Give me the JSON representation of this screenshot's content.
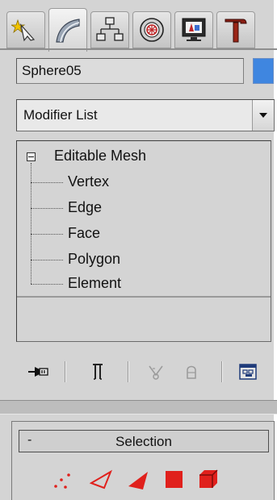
{
  "command_panel": {
    "tabs": [
      {
        "icon": "create-icon",
        "active": false
      },
      {
        "icon": "modify-icon",
        "active": true
      },
      {
        "icon": "hierarchy-icon",
        "active": false
      },
      {
        "icon": "motion-icon",
        "active": false
      },
      {
        "icon": "display-icon",
        "active": false
      },
      {
        "icon": "utilities-icon",
        "active": false
      }
    ]
  },
  "object": {
    "name": "Sphere05",
    "color": "#3f86e0"
  },
  "modifier_list": {
    "label": "Modifier List"
  },
  "stack": {
    "root": "Editable Mesh",
    "items": [
      "Vertex",
      "Edge",
      "Face",
      "Polygon",
      "Element"
    ]
  },
  "stack_tools": [
    {
      "icon": "pin-stack-icon"
    },
    {
      "icon": "show-end-result-icon"
    },
    {
      "icon": "make-unique-icon"
    },
    {
      "icon": "remove-modifier-icon"
    },
    {
      "icon": "configure-modifier-sets-icon"
    }
  ],
  "selection_rollout": {
    "toggle": "-",
    "title": "Selection",
    "icons": [
      "vertex-select-icon",
      "edge-select-icon",
      "face-select-icon",
      "polygon-select-icon",
      "element-select-icon"
    ],
    "icon_color": "#e0201c"
  }
}
